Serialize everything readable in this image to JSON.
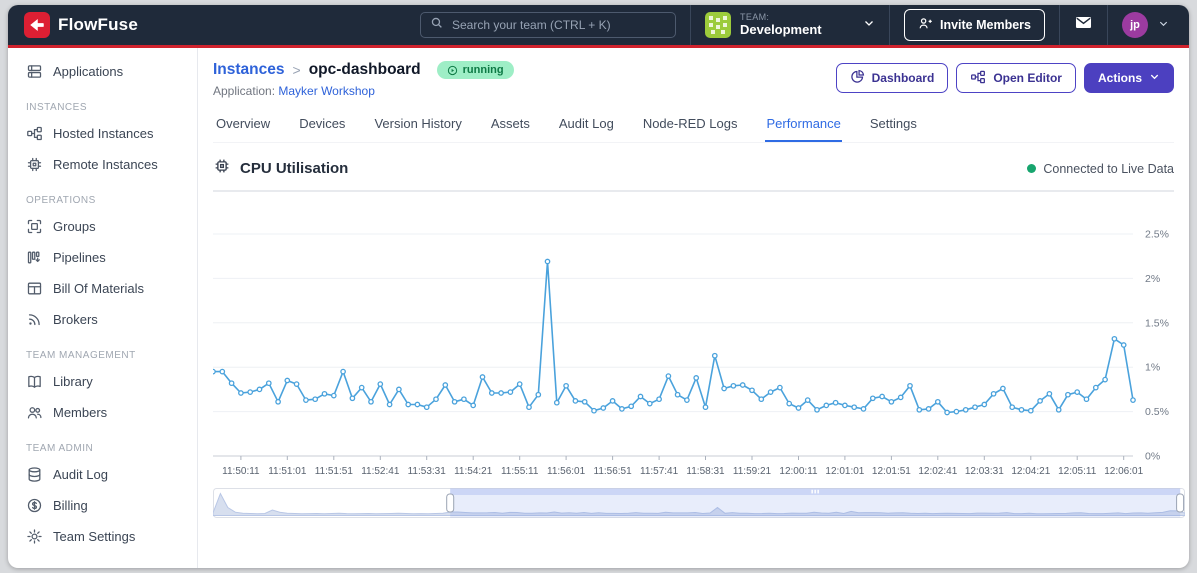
{
  "navbar": {
    "brand": "FlowFuse",
    "search": {
      "placeholder": "Search your team (CTRL + K)"
    },
    "team": {
      "label": "TEAM:",
      "name": "Development"
    },
    "invite_button": "Invite Members",
    "user": {
      "initials": "jp"
    }
  },
  "sidebar": {
    "sections": [
      {
        "header": "",
        "items": [
          {
            "label": "Applications",
            "icon": "applications-icon"
          }
        ]
      },
      {
        "header": "INSTANCES",
        "items": [
          {
            "label": "Hosted Instances",
            "icon": "hosted-instances-icon"
          },
          {
            "label": "Remote Instances",
            "icon": "remote-instances-icon"
          }
        ]
      },
      {
        "header": "OPERATIONS",
        "items": [
          {
            "label": "Groups",
            "icon": "groups-icon"
          },
          {
            "label": "Pipelines",
            "icon": "pipelines-icon"
          },
          {
            "label": "Bill Of Materials",
            "icon": "bill-of-materials-icon"
          },
          {
            "label": "Brokers",
            "icon": "brokers-icon"
          }
        ]
      },
      {
        "header": "TEAM MANAGEMENT",
        "items": [
          {
            "label": "Library",
            "icon": "library-icon"
          },
          {
            "label": "Members",
            "icon": "members-icon"
          }
        ]
      },
      {
        "header": "TEAM ADMIN",
        "items": [
          {
            "label": "Audit Log",
            "icon": "audit-log-icon"
          },
          {
            "label": "Billing",
            "icon": "billing-icon"
          },
          {
            "label": "Team Settings",
            "icon": "team-settings-icon"
          }
        ]
      }
    ]
  },
  "page": {
    "breadcrumb": {
      "parent": "Instances",
      "separator": ">",
      "current": "opc-dashboard"
    },
    "status_badge": "running",
    "application": {
      "label": "Application:",
      "name": "Mayker Workshop"
    },
    "buttons": {
      "dashboard": "Dashboard",
      "open_editor": "Open Editor",
      "actions": "Actions"
    }
  },
  "tabs": {
    "items": [
      "Overview",
      "Devices",
      "Version History",
      "Assets",
      "Audit Log",
      "Node-RED Logs",
      "Performance",
      "Settings"
    ],
    "active": "Performance"
  },
  "chart_panel": {
    "title": "CPU Utilisation",
    "status": "Connected to Live Data"
  },
  "chart_data": {
    "type": "line",
    "title": "CPU Utilisation",
    "unit": "percent",
    "series_name": "CPU utilisation %",
    "grid": true,
    "y_axis_side": "right",
    "y_ticks": [
      "0%",
      "0.5%",
      "1%",
      "1.5%",
      "2%",
      "2.5%"
    ],
    "ylim": [
      0,
      2.75
    ],
    "x_tick_labels": [
      "11:50:11",
      "11:51:01",
      "11:51:51",
      "11:52:41",
      "11:53:31",
      "11:54:21",
      "11:55:11",
      "11:56:01",
      "11:56:51",
      "11:57:41",
      "11:58:31",
      "11:59:21",
      "12:00:11",
      "12:01:01",
      "12:01:51",
      "12:02:41",
      "12:03:31",
      "12:04:21",
      "12:05:11",
      "12:06:01"
    ],
    "sample_interval_seconds": 10,
    "x_first_tick_index": 3,
    "x_points_per_tick": 5,
    "values": [
      0.95,
      0.95,
      0.82,
      0.71,
      0.72,
      0.75,
      0.82,
      0.61,
      0.85,
      0.81,
      0.63,
      0.64,
      0.7,
      0.68,
      0.95,
      0.65,
      0.77,
      0.61,
      0.81,
      0.58,
      0.75,
      0.58,
      0.58,
      0.55,
      0.64,
      0.8,
      0.61,
      0.64,
      0.57,
      0.89,
      0.71,
      0.71,
      0.72,
      0.81,
      0.55,
      0.69,
      2.19,
      0.6,
      0.79,
      0.62,
      0.61,
      0.51,
      0.54,
      0.62,
      0.53,
      0.56,
      0.67,
      0.59,
      0.64,
      0.9,
      0.69,
      0.63,
      0.88,
      0.55,
      1.13,
      0.76,
      0.79,
      0.8,
      0.74,
      0.64,
      0.72,
      0.77,
      0.59,
      0.54,
      0.63,
      0.52,
      0.57,
      0.6,
      0.57,
      0.55,
      0.53,
      0.65,
      0.67,
      0.61,
      0.66,
      0.79,
      0.52,
      0.53,
      0.61,
      0.49,
      0.5,
      0.52,
      0.55,
      0.58,
      0.7,
      0.76,
      0.55,
      0.52,
      0.51,
      0.62,
      0.7,
      0.52,
      0.69,
      0.72,
      0.64,
      0.77,
      0.86,
      1.32,
      1.25,
      0.63
    ],
    "line_color": "#4AA2DC",
    "navigator": {
      "prefix_values": [
        0.7,
        6.0,
        2.2,
        0.9,
        0.6,
        0.55,
        0.5,
        0.55,
        1.5,
        0.9,
        0.6,
        0.55,
        0.5,
        0.52,
        0.55,
        0.5,
        0.55,
        0.6,
        0.52,
        0.5,
        0.52,
        0.55,
        0.5,
        0.52,
        0.55,
        0.6,
        0.55,
        0.5,
        0.52,
        0.5,
        0.55,
        0.6
      ],
      "selection_start_pct": 24.4,
      "selection_end_pct": 99.5
    }
  },
  "colors": {
    "navbar_bg": "#1f2a3a",
    "accent_red": "#d0222d",
    "brand_indigo": "#4c40c0",
    "link_blue": "#2e62d9",
    "active_tab_blue": "#2f6be4",
    "running_badge_bg": "#9eeec6",
    "running_badge_text": "#0d7a45",
    "live_dot_green": "#17a56e",
    "line_blue": "#4AA2DC"
  }
}
